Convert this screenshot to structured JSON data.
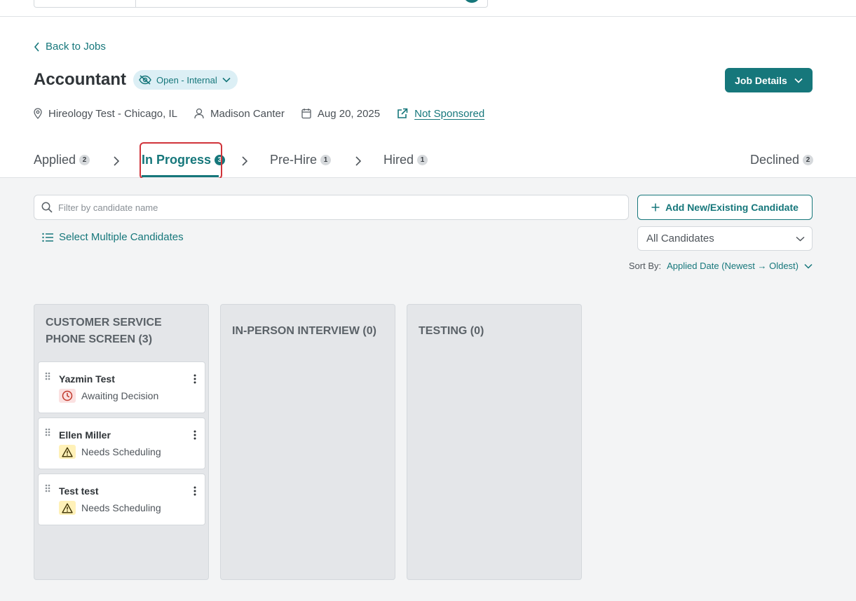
{
  "back": {
    "label": "Back to Jobs"
  },
  "job": {
    "title": "Accountant",
    "status": "Open - Internal",
    "details_button": "Job Details",
    "location": "Hireology Test - Chicago, IL",
    "recruiter": "Madison Canter",
    "date": "Aug 20, 2025",
    "sponsorship": "Not Sponsored"
  },
  "tabs": [
    {
      "label": "Applied",
      "count": "2"
    },
    {
      "label": "In Progress",
      "count": "3"
    },
    {
      "label": "Pre-Hire",
      "count": "1"
    },
    {
      "label": "Hired",
      "count": "1"
    },
    {
      "label": "Declined",
      "count": "2"
    }
  ],
  "toolbar": {
    "filter_placeholder": "Filter by candidate name",
    "add_button": "Add New/Existing Candidate",
    "select_multiple": "Select Multiple Candidates",
    "candidate_filter": "All Candidates",
    "sort_label": "Sort By:",
    "sort_value": "Applied Date (Newest → Oldest)"
  },
  "columns": [
    {
      "title": "CUSTOMER SERVICE PHONE SCREEN (3)",
      "cards": [
        {
          "name": "Yazmin Test",
          "status": "Awaiting Decision",
          "status_type": "clock-icon"
        },
        {
          "name": "Ellen Miller",
          "status": "Needs Scheduling",
          "status_type": "warning-icon"
        },
        {
          "name": "Test test",
          "status": "Needs Scheduling",
          "status_type": "warning-icon"
        }
      ]
    },
    {
      "title": "IN-PERSON INTERVIEW (0)",
      "cards": []
    },
    {
      "title": "TESTING (0)",
      "cards": []
    }
  ],
  "colors": {
    "accent": "#16777b",
    "highlight": "#d0333a",
    "awaiting": "#c0392b",
    "warning": "#8a6d00"
  }
}
